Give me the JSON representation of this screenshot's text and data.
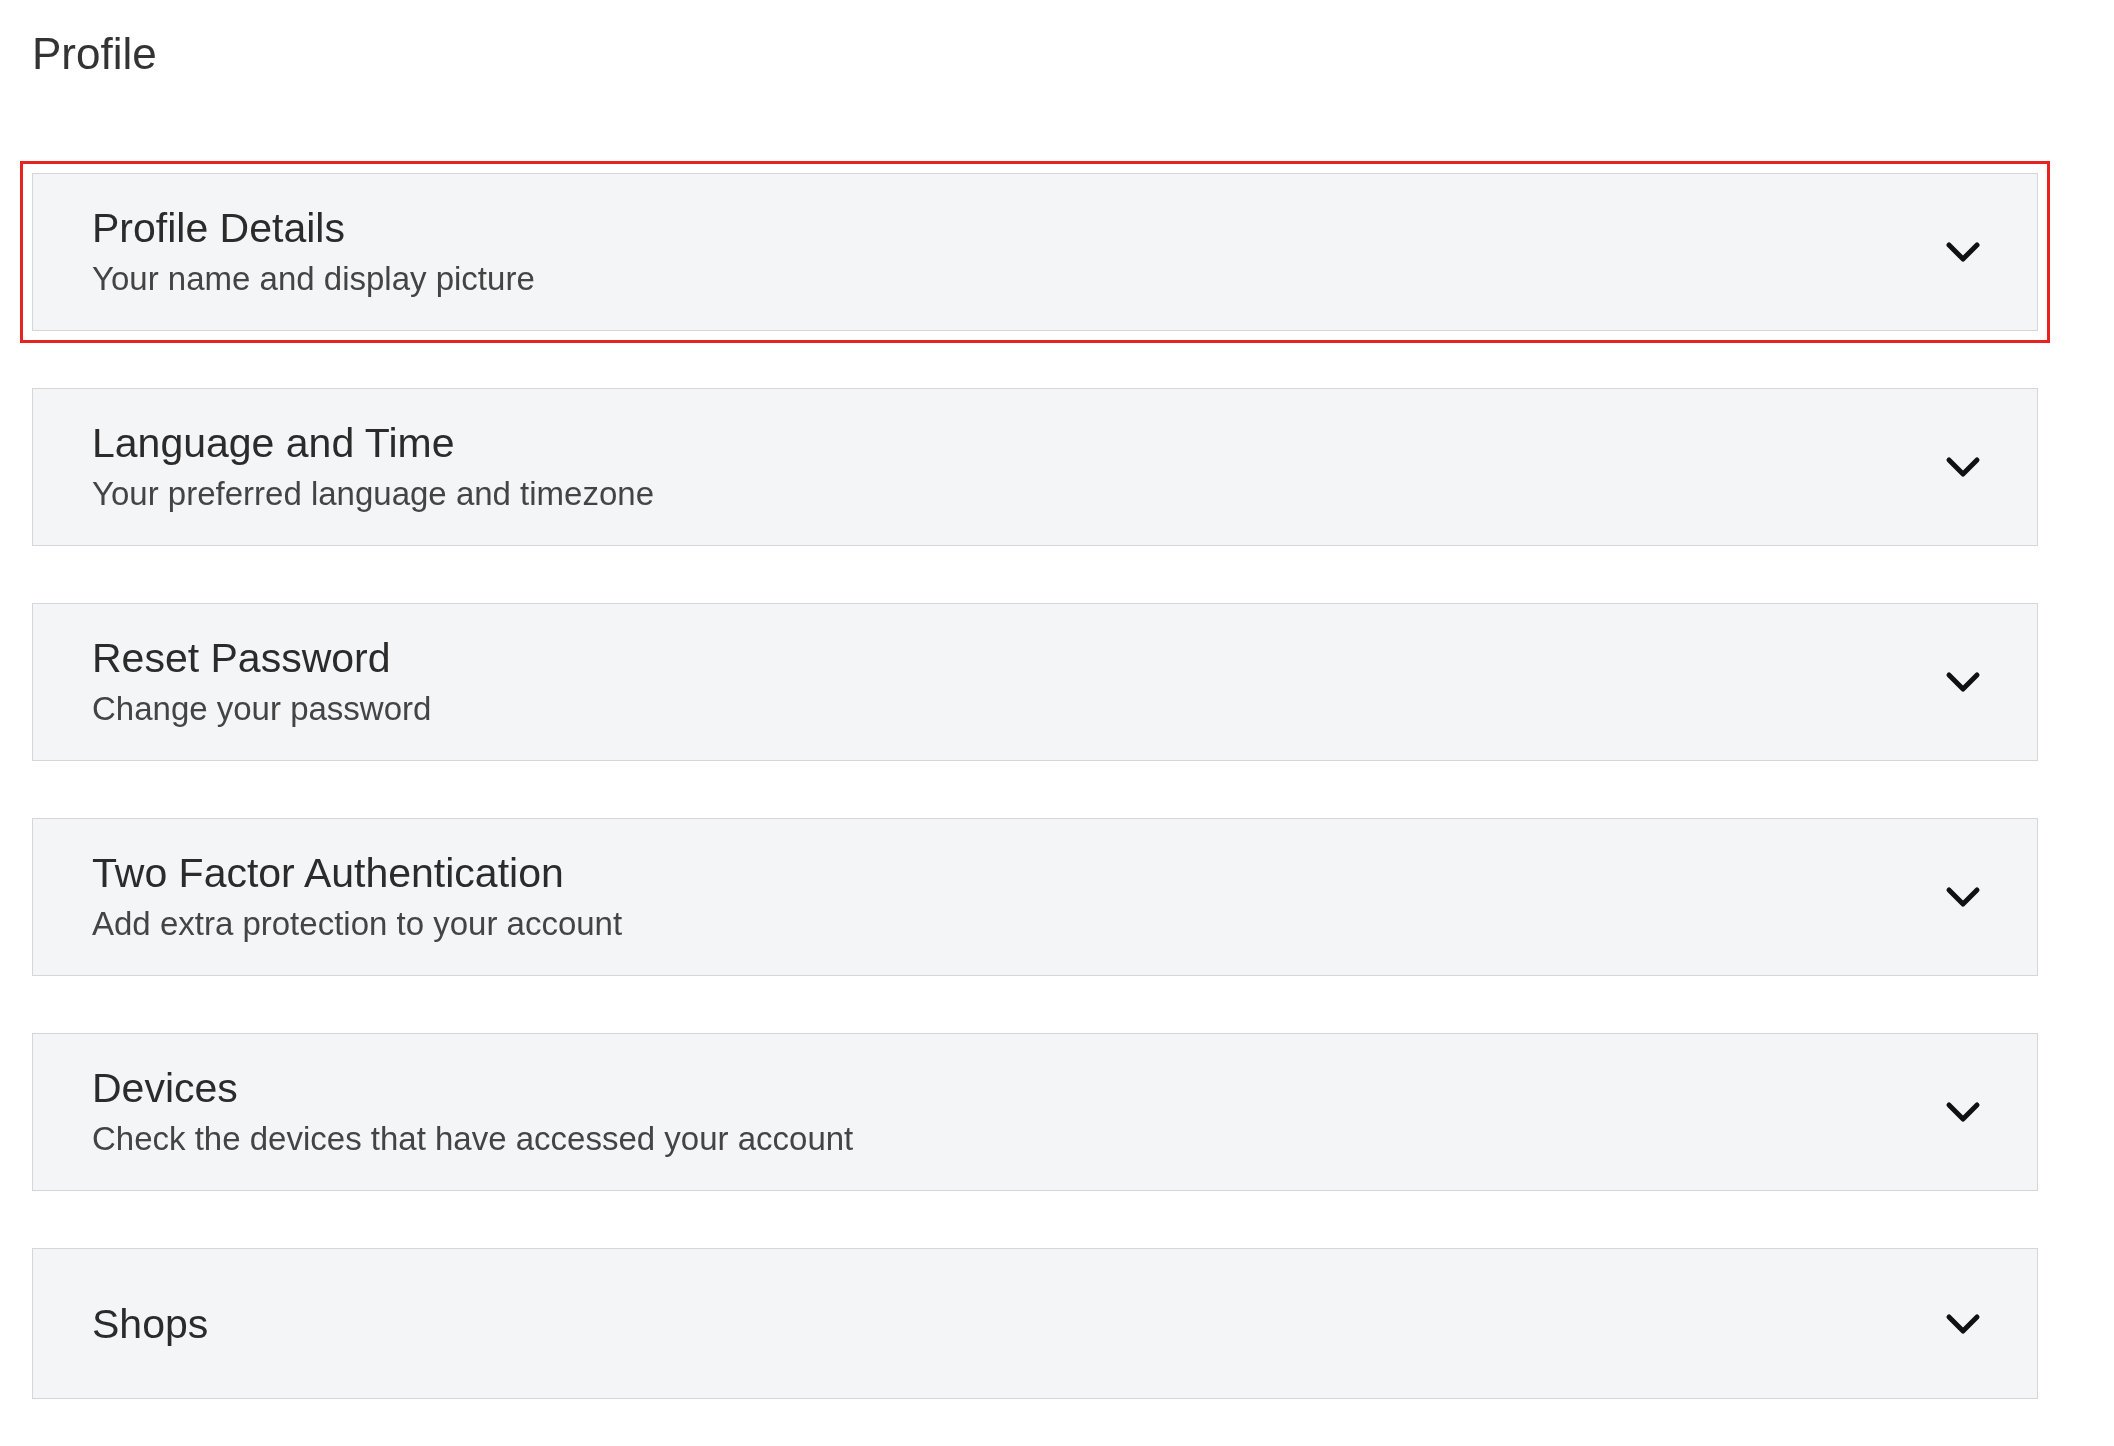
{
  "page": {
    "title": "Profile"
  },
  "sections": [
    {
      "title": "Profile Details",
      "subtitle": "Your name and display picture",
      "highlighted": true,
      "expanded": false
    },
    {
      "title": "Language and Time",
      "subtitle": "Your preferred language and timezone",
      "highlighted": false,
      "expanded": false
    },
    {
      "title": "Reset Password",
      "subtitle": "Change your password",
      "highlighted": false,
      "expanded": false
    },
    {
      "title": "Two Factor Authentication",
      "subtitle": "Add extra protection to your account",
      "highlighted": false,
      "expanded": false
    },
    {
      "title": "Devices",
      "subtitle": "Check the devices that have accessed your account",
      "highlighted": false,
      "expanded": false
    },
    {
      "title": "Shops",
      "highlighted": false,
      "expanded": false
    }
  ]
}
